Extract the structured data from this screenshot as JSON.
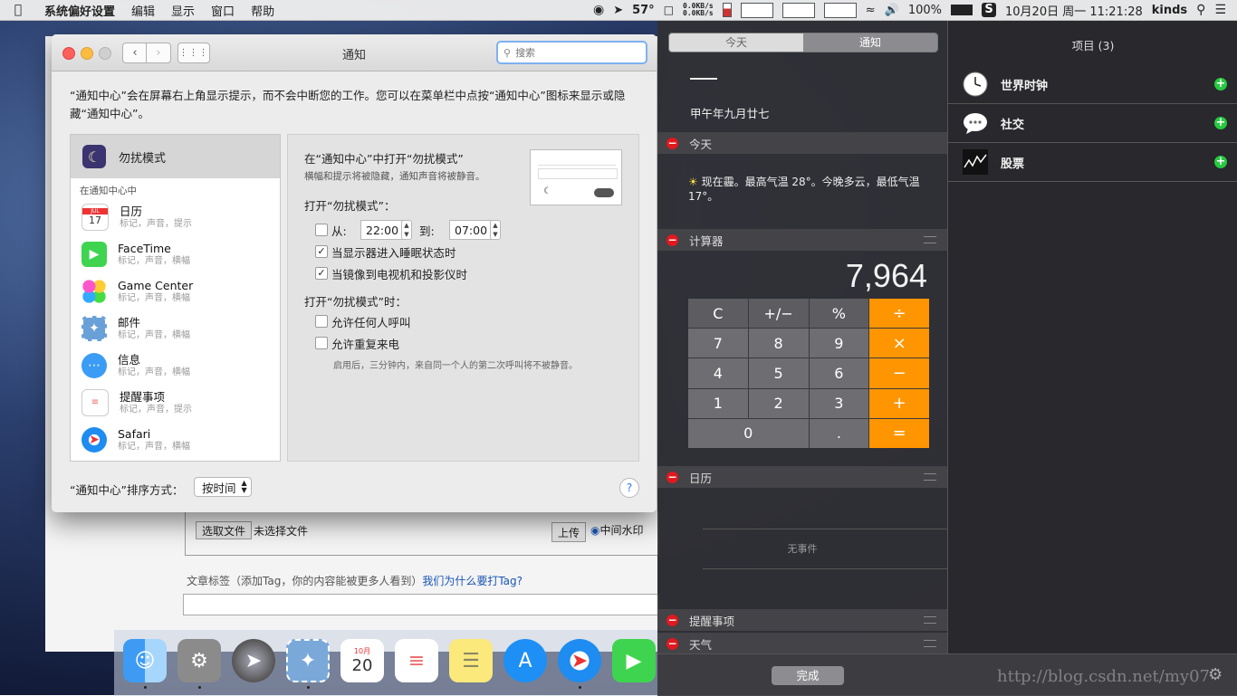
{
  "menubar": {
    "app_name": "系统偏好设置",
    "items": [
      "编辑",
      "显示",
      "窗口",
      "帮助"
    ],
    "temperature": "57°",
    "net_up": "0.0KB/s",
    "net_down": "0.0KB/s",
    "battery": "100%",
    "datetime": "10月20日 周一  11:21:28",
    "user": "kinds"
  },
  "webpage": {
    "choose_file": "选取文件",
    "no_file": "未选择文件",
    "upload": "上传",
    "watermark_option": "中间水印",
    "tags_label": "文章标签（添加Tag，你的内容能被更多人看到）",
    "tags_link": "我们为什么要打Tag?"
  },
  "prefwin": {
    "title": "通知",
    "search_placeholder": "搜索",
    "description": "“通知中心”会在屏幕右上角显示提示，而不会中断您的工作。您可以在菜单栏中点按“通知中心”图标来显示或隐藏“通知中心”。",
    "dnd_label": "勿扰模式",
    "section_header": "在通知中心中",
    "apps": [
      {
        "name": "日历",
        "sub": "标记，声音，提示"
      },
      {
        "name": "FaceTime",
        "sub": "标记，声音，横幅"
      },
      {
        "name": "Game Center",
        "sub": "标记，声音，横幅"
      },
      {
        "name": "邮件",
        "sub": "标记，声音，横幅"
      },
      {
        "name": "信息",
        "sub": "标记，声音，横幅"
      },
      {
        "name": "提醒事项",
        "sub": "标记，声音，提示"
      },
      {
        "name": "Safari",
        "sub": "标记，声音，横幅"
      }
    ],
    "detail": {
      "title": "在“通知中心”中打开“勿扰模式”",
      "subtitle": "横幅和提示将被隐藏，通知声音将被静音。",
      "turn_on_header": "打开“勿扰模式”：",
      "from_label": "从:",
      "from_time": "22:00",
      "to_label": "到:",
      "to_time": "07:00",
      "opt_sleep": "当显示器进入睡眠状态时",
      "opt_mirror": "当镜像到电视机和投影仪时",
      "when_on_header": "打开“勿扰模式”时：",
      "opt_anyone": "允许任何人呼叫",
      "opt_repeat": "允许重复来电",
      "hint": "启用后，三分钟内，来自同一个人的第二次呼叫将不被静音。"
    },
    "sort_label": "“通知中心”排序方式：",
    "sort_value": "按时间"
  },
  "nc": {
    "tab_today": "今天",
    "tab_notifications": "通知",
    "lunar_date": "甲午年九月廿七",
    "today_title": "今天",
    "weather_text": "现在霾。最高气温 28°。今晚多云，最低气温 17°。",
    "calc_title": "计算器",
    "calc_display": "7,964",
    "calc_keys": [
      "C",
      "+/−",
      "%",
      "÷",
      "7",
      "8",
      "9",
      "×",
      "4",
      "5",
      "6",
      "−",
      "1",
      "2",
      "3",
      "+",
      "0",
      ".",
      "="
    ],
    "calendar_title": "日历",
    "no_events": "无事件",
    "reminders_title": "提醒事项",
    "weather_title": "天气",
    "items_title": "项目 (3)",
    "items": [
      {
        "name": "世界时钟",
        "icon": "clock-icon"
      },
      {
        "name": "社交",
        "icon": "speech-bubble-icon"
      },
      {
        "name": "股票",
        "icon": "stocks-chart-icon"
      }
    ],
    "done_label": "完成",
    "watermark": "http://blog.csdn.net/my07"
  },
  "colors": {
    "accent_orange": "#ff9500",
    "minus_red": "#e0191e",
    "plus_green": "#27c93f",
    "focus_blue": "#7fb1ef"
  }
}
